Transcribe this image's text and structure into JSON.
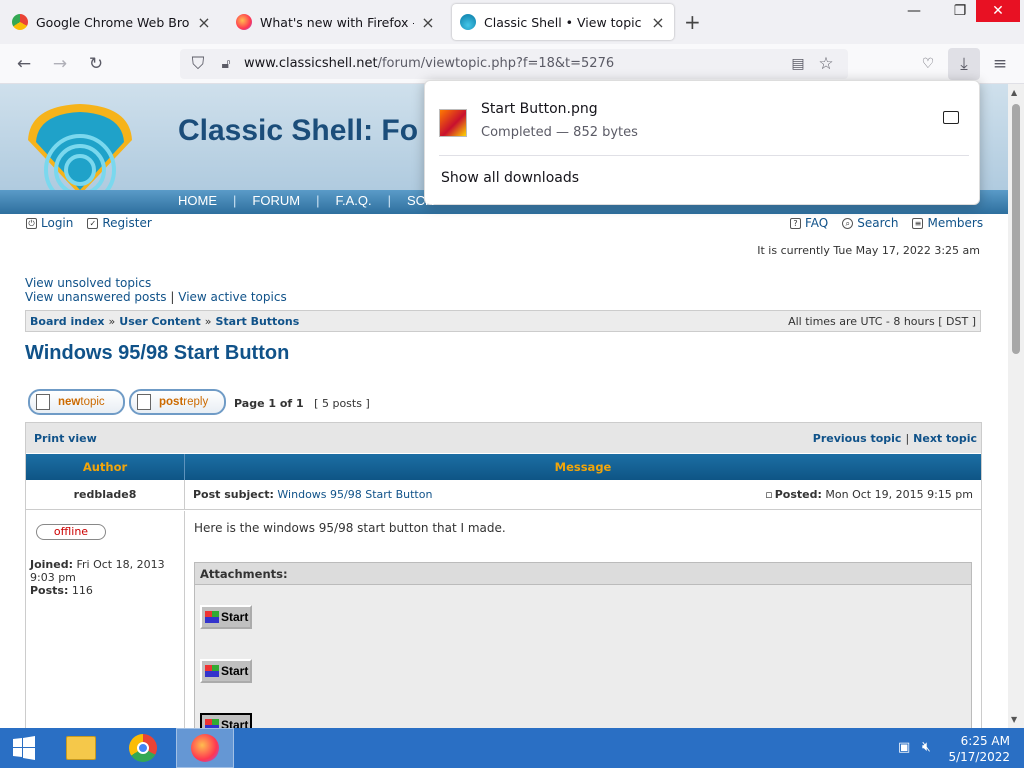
{
  "browser": {
    "tabs": [
      {
        "title": "Google Chrome Web Browser"
      },
      {
        "title": "What's new with Firefox - More"
      },
      {
        "title": "Classic Shell • View topic - Win"
      }
    ],
    "new_tab": "+",
    "url_host": "www.classicshell.net",
    "url_path": "/forum/viewtopic.php?f=18&t=5276"
  },
  "downloads": {
    "filename": "Start Button.png",
    "status": "Completed — 852 bytes",
    "show_all": "Show all downloads"
  },
  "site": {
    "title": "Classic Shell: Fo",
    "nav": [
      "HOME",
      "FORUM",
      "F.A.Q.",
      "SCR"
    ],
    "login": "Login",
    "register": "Register",
    "faq": "FAQ",
    "search": "Search",
    "members": "Members",
    "current_time": "It is currently Tue May 17, 2022 3:25 am",
    "link_unsolved": "View unsolved topics",
    "link_unanswered": "View unanswered posts",
    "link_sep": "|",
    "link_active": "View active topics",
    "crumbs": [
      "Board index",
      "User Content",
      "Start Buttons"
    ],
    "crumb_sep": "»",
    "timezone": "All times are UTC - 8 hours [ DST ]"
  },
  "topic": {
    "title": "Windows 95/98 Start Button",
    "newtopic_a": "new",
    "newtopic_b": "topic",
    "postreply_a": "post",
    "postreply_b": "reply",
    "page_info": "Page 1 of 1",
    "posts_count": "[ 5 posts ]",
    "print_view": "Print view",
    "prev_topic": "Previous topic",
    "next_sep": "|",
    "next_topic": "Next topic",
    "col_author": "Author",
    "col_message": "Message"
  },
  "post": {
    "author": "redblade8",
    "subject_label": "Post subject:",
    "subject": "Windows 95/98 Start Button",
    "posted_label": "Posted:",
    "posted_date": "Mon Oct 19, 2015 9:15 pm",
    "status": "offline",
    "joined_label": "Joined:",
    "joined_value": "Fri Oct 18, 2013 9:03 pm",
    "posts_label": "Posts:",
    "posts_value": "116",
    "body": "Here is the windows 95/98 start button that I made.",
    "attachments_label": "Attachments:",
    "start_label": "Start"
  },
  "taskbar": {
    "time": "6:25 AM",
    "date": "5/17/2022"
  }
}
